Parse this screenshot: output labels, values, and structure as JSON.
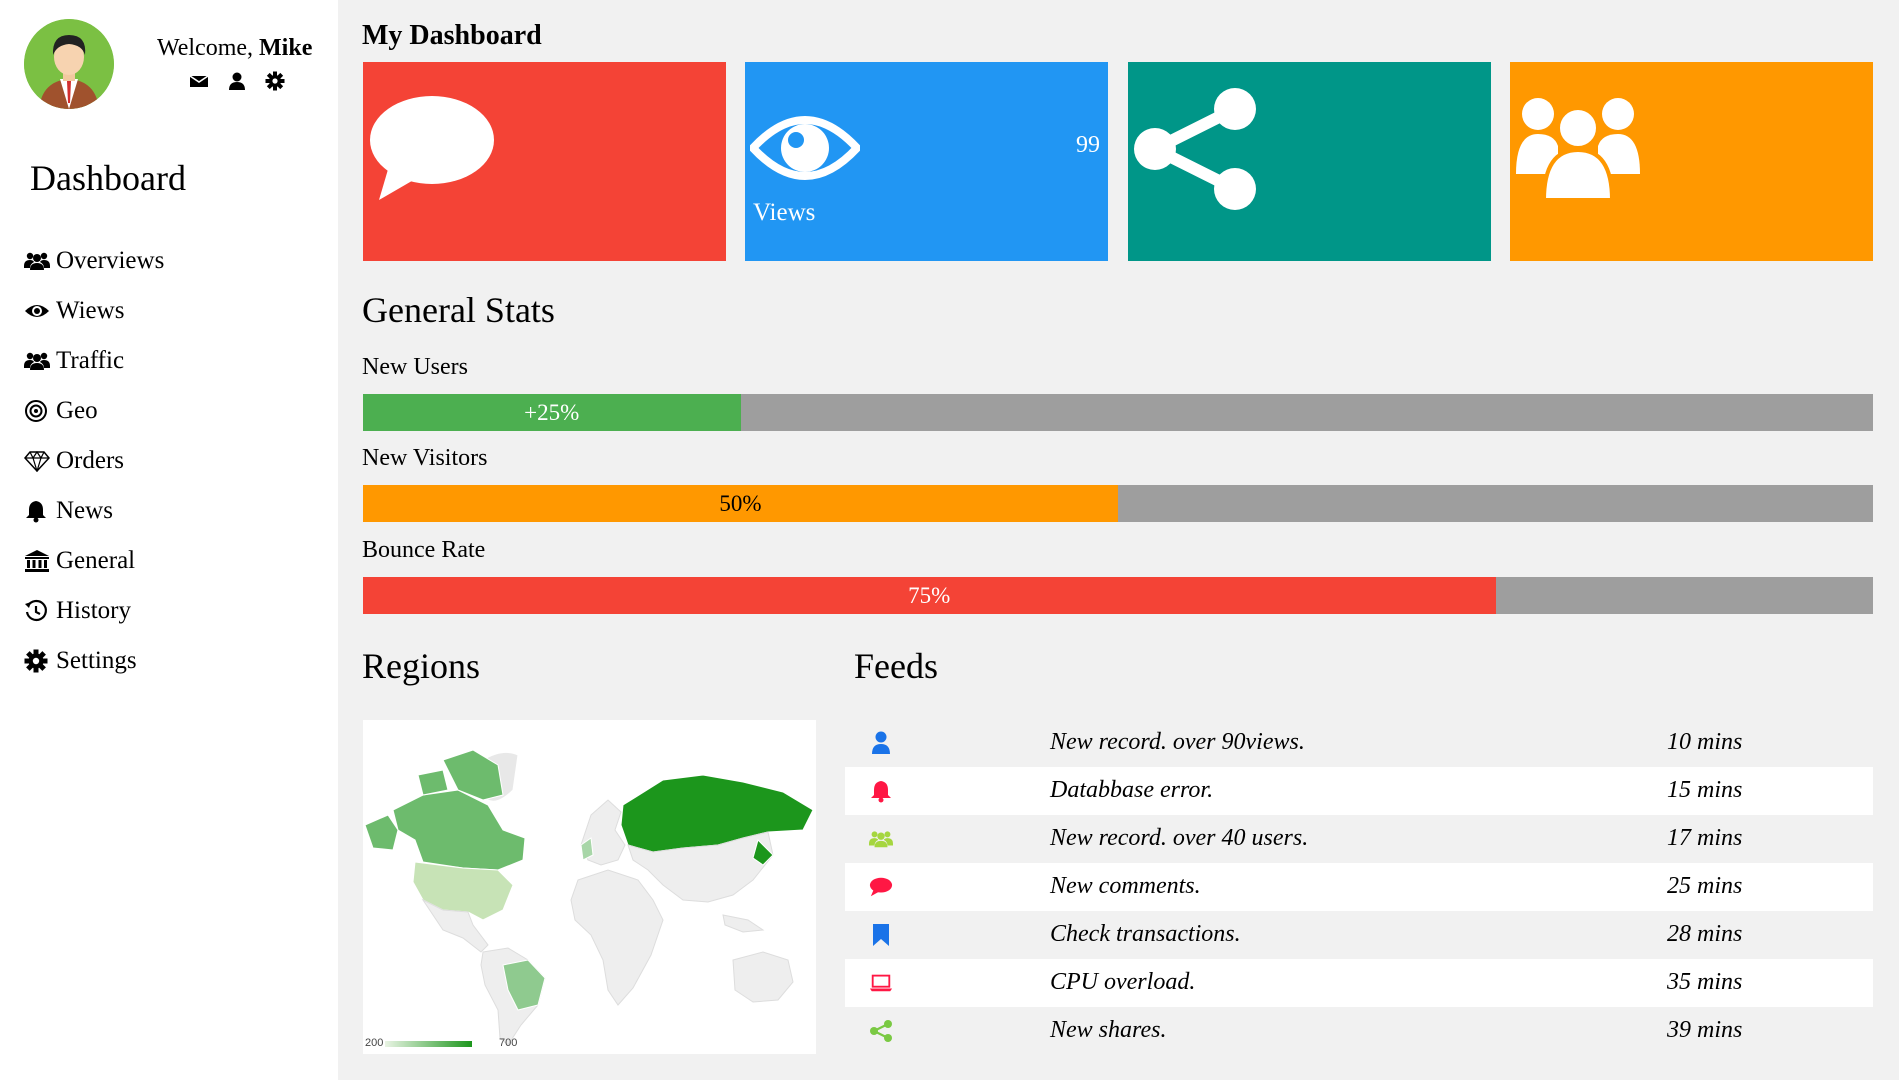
{
  "profile": {
    "welcome_prefix": "Welcome,",
    "user_name": "Mike",
    "icons": [
      "envelope-icon",
      "user-icon",
      "gear-icon"
    ]
  },
  "sidebar": {
    "title": "Dashboard",
    "items": [
      {
        "label": "Overviews",
        "icon": "users-icon"
      },
      {
        "label": "Wiews",
        "icon": "eye-icon"
      },
      {
        "label": "Traffic",
        "icon": "users-icon"
      },
      {
        "label": "Geo",
        "icon": "bullseye-icon"
      },
      {
        "label": "Orders",
        "icon": "diamond-icon"
      },
      {
        "label": "News",
        "icon": "bell-icon"
      },
      {
        "label": "General",
        "icon": "bank-icon"
      },
      {
        "label": "History",
        "icon": "history-icon"
      },
      {
        "label": "Settings",
        "icon": "gear-icon"
      }
    ]
  },
  "main": {
    "title": "My Dashboard",
    "tiles": [
      {
        "icon": "comment-icon",
        "color": "#f44336",
        "value": "",
        "label": ""
      },
      {
        "icon": "eye-icon",
        "color": "#2196f3",
        "value": "99",
        "label": "Views"
      },
      {
        "icon": "share-icon",
        "color": "#009688",
        "value": "",
        "label": ""
      },
      {
        "icon": "users-icon",
        "color": "#ff9800",
        "value": "",
        "label": ""
      }
    ]
  },
  "stats": {
    "title": "General Stats",
    "items": [
      {
        "label": "New Users",
        "value_text": "+25%",
        "percent": 25,
        "color": "#4caf50",
        "text_color": "#ffffff"
      },
      {
        "label": "New Visitors",
        "value_text": "50%",
        "percent": 50,
        "color": "#ff9800",
        "text_color": "#000000"
      },
      {
        "label": "Bounce Rate",
        "value_text": "75%",
        "percent": 75,
        "color": "#f44336",
        "text_color": "#ffffff"
      }
    ]
  },
  "regions": {
    "title": "Regions",
    "legend_min": "200",
    "legend_max": "700"
  },
  "feeds": {
    "title": "Feeds",
    "items": [
      {
        "icon": "user-icon",
        "color": "#1a73e8",
        "text": "New record. over 90views.",
        "time": "10 mins"
      },
      {
        "icon": "bell-icon",
        "color": "#ff1744",
        "text": "Databbase error.",
        "time": "15 mins"
      },
      {
        "icon": "users-icon",
        "color": "#a5d63f",
        "text": "New record. over 40 users.",
        "time": "17 mins"
      },
      {
        "icon": "comment-icon",
        "color": "#ff1744",
        "text": "New comments.",
        "time": "25 mins"
      },
      {
        "icon": "bookmark-icon",
        "color": "#1a73e8",
        "text": "Check transactions.",
        "time": "28 mins"
      },
      {
        "icon": "laptop-icon",
        "color": "#ff1744",
        "text": "CPU overload.",
        "time": "35 mins"
      },
      {
        "icon": "share-icon",
        "color": "#7ac943",
        "text": "New shares.",
        "time": "39 mins"
      }
    ]
  }
}
